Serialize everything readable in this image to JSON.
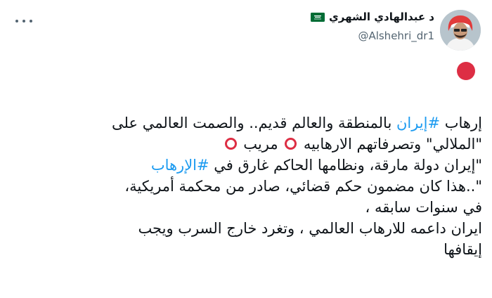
{
  "author": {
    "display_name": "د عبدالهادي الشهري",
    "handle": "@Alshehri_dr1",
    "flag": "saudi-flag-icon"
  },
  "menu": {
    "icon": "more-horizontal-icon"
  },
  "marker": {
    "icon": "red-circle-icon",
    "color": "#dd2e44"
  },
  "tweet": {
    "line1": {
      "a": "إرهاب ",
      "tag": "#إيران",
      "b": " بالمنطقة والعالم قديم.. والصمت العالمي على"
    },
    "line2": {
      "a": "\"الملالي\" وتصرفاتهم الارهابيه ",
      "b": " مريب "
    },
    "line3": {
      "a": "\"إيران دولة مارقة، ونظامها الحاكم غارق في ",
      "tag": "#الإرهاب"
    },
    "line4": "\"..هذا كان مضمون حكم قضائي، صادر من محكمة أمريكية،",
    "line5": "في سنوات سابقه ،",
    "line6": "ايران داعمه للارهاب العالمي ، وتغرد خارج السرب ويجب",
    "line7": "إيقافها"
  },
  "colors": {
    "hashtag": "#1d9bf0",
    "text": "#0f1419",
    "secondary": "#536471"
  }
}
